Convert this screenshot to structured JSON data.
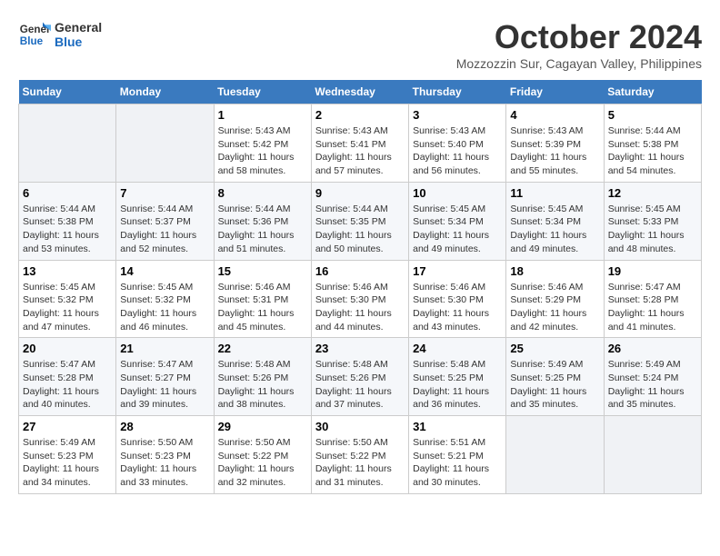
{
  "header": {
    "logo_line1": "General",
    "logo_line2": "Blue",
    "month": "October 2024",
    "location": "Mozzozzin Sur, Cagayan Valley, Philippines"
  },
  "weekdays": [
    "Sunday",
    "Monday",
    "Tuesday",
    "Wednesday",
    "Thursday",
    "Friday",
    "Saturday"
  ],
  "weeks": [
    [
      {
        "day": "",
        "content": ""
      },
      {
        "day": "",
        "content": ""
      },
      {
        "day": "1",
        "content": "Sunrise: 5:43 AM\nSunset: 5:42 PM\nDaylight: 11 hours and 58 minutes."
      },
      {
        "day": "2",
        "content": "Sunrise: 5:43 AM\nSunset: 5:41 PM\nDaylight: 11 hours and 57 minutes."
      },
      {
        "day": "3",
        "content": "Sunrise: 5:43 AM\nSunset: 5:40 PM\nDaylight: 11 hours and 56 minutes."
      },
      {
        "day": "4",
        "content": "Sunrise: 5:43 AM\nSunset: 5:39 PM\nDaylight: 11 hours and 55 minutes."
      },
      {
        "day": "5",
        "content": "Sunrise: 5:44 AM\nSunset: 5:38 PM\nDaylight: 11 hours and 54 minutes."
      }
    ],
    [
      {
        "day": "6",
        "content": "Sunrise: 5:44 AM\nSunset: 5:38 PM\nDaylight: 11 hours and 53 minutes."
      },
      {
        "day": "7",
        "content": "Sunrise: 5:44 AM\nSunset: 5:37 PM\nDaylight: 11 hours and 52 minutes."
      },
      {
        "day": "8",
        "content": "Sunrise: 5:44 AM\nSunset: 5:36 PM\nDaylight: 11 hours and 51 minutes."
      },
      {
        "day": "9",
        "content": "Sunrise: 5:44 AM\nSunset: 5:35 PM\nDaylight: 11 hours and 50 minutes."
      },
      {
        "day": "10",
        "content": "Sunrise: 5:45 AM\nSunset: 5:34 PM\nDaylight: 11 hours and 49 minutes."
      },
      {
        "day": "11",
        "content": "Sunrise: 5:45 AM\nSunset: 5:34 PM\nDaylight: 11 hours and 49 minutes."
      },
      {
        "day": "12",
        "content": "Sunrise: 5:45 AM\nSunset: 5:33 PM\nDaylight: 11 hours and 48 minutes."
      }
    ],
    [
      {
        "day": "13",
        "content": "Sunrise: 5:45 AM\nSunset: 5:32 PM\nDaylight: 11 hours and 47 minutes."
      },
      {
        "day": "14",
        "content": "Sunrise: 5:45 AM\nSunset: 5:32 PM\nDaylight: 11 hours and 46 minutes."
      },
      {
        "day": "15",
        "content": "Sunrise: 5:46 AM\nSunset: 5:31 PM\nDaylight: 11 hours and 45 minutes."
      },
      {
        "day": "16",
        "content": "Sunrise: 5:46 AM\nSunset: 5:30 PM\nDaylight: 11 hours and 44 minutes."
      },
      {
        "day": "17",
        "content": "Sunrise: 5:46 AM\nSunset: 5:30 PM\nDaylight: 11 hours and 43 minutes."
      },
      {
        "day": "18",
        "content": "Sunrise: 5:46 AM\nSunset: 5:29 PM\nDaylight: 11 hours and 42 minutes."
      },
      {
        "day": "19",
        "content": "Sunrise: 5:47 AM\nSunset: 5:28 PM\nDaylight: 11 hours and 41 minutes."
      }
    ],
    [
      {
        "day": "20",
        "content": "Sunrise: 5:47 AM\nSunset: 5:28 PM\nDaylight: 11 hours and 40 minutes."
      },
      {
        "day": "21",
        "content": "Sunrise: 5:47 AM\nSunset: 5:27 PM\nDaylight: 11 hours and 39 minutes."
      },
      {
        "day": "22",
        "content": "Sunrise: 5:48 AM\nSunset: 5:26 PM\nDaylight: 11 hours and 38 minutes."
      },
      {
        "day": "23",
        "content": "Sunrise: 5:48 AM\nSunset: 5:26 PM\nDaylight: 11 hours and 37 minutes."
      },
      {
        "day": "24",
        "content": "Sunrise: 5:48 AM\nSunset: 5:25 PM\nDaylight: 11 hours and 36 minutes."
      },
      {
        "day": "25",
        "content": "Sunrise: 5:49 AM\nSunset: 5:25 PM\nDaylight: 11 hours and 35 minutes."
      },
      {
        "day": "26",
        "content": "Sunrise: 5:49 AM\nSunset: 5:24 PM\nDaylight: 11 hours and 35 minutes."
      }
    ],
    [
      {
        "day": "27",
        "content": "Sunrise: 5:49 AM\nSunset: 5:23 PM\nDaylight: 11 hours and 34 minutes."
      },
      {
        "day": "28",
        "content": "Sunrise: 5:50 AM\nSunset: 5:23 PM\nDaylight: 11 hours and 33 minutes."
      },
      {
        "day": "29",
        "content": "Sunrise: 5:50 AM\nSunset: 5:22 PM\nDaylight: 11 hours and 32 minutes."
      },
      {
        "day": "30",
        "content": "Sunrise: 5:50 AM\nSunset: 5:22 PM\nDaylight: 11 hours and 31 minutes."
      },
      {
        "day": "31",
        "content": "Sunrise: 5:51 AM\nSunset: 5:21 PM\nDaylight: 11 hours and 30 minutes."
      },
      {
        "day": "",
        "content": ""
      },
      {
        "day": "",
        "content": ""
      }
    ]
  ]
}
